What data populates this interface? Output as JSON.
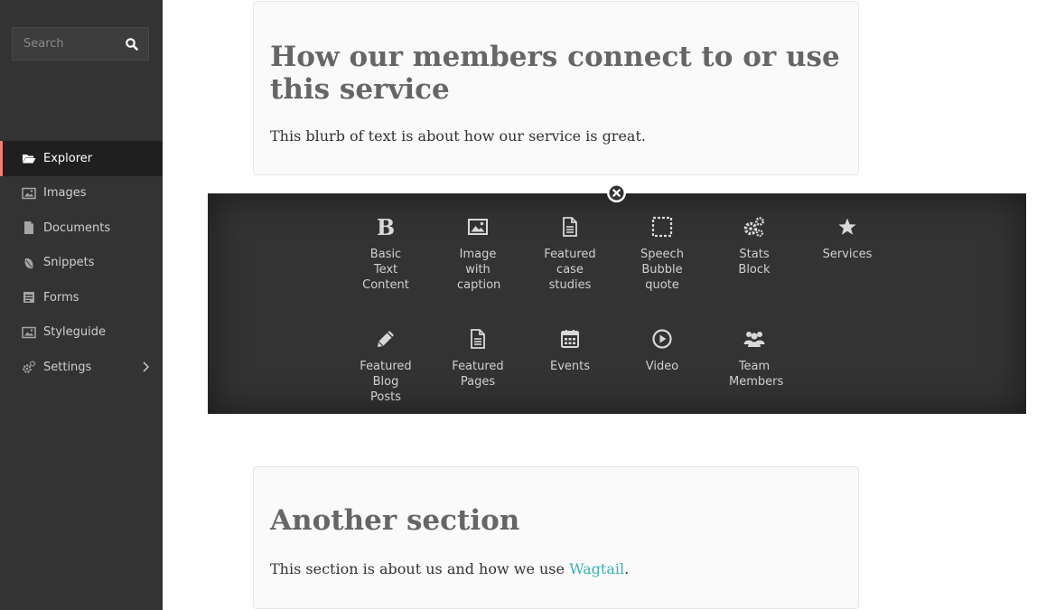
{
  "sidebar": {
    "search": {
      "placeholder": "Search"
    },
    "items": [
      {
        "label": "Explorer",
        "icon": "folder-open-icon",
        "active": true
      },
      {
        "label": "Images",
        "icon": "image-icon"
      },
      {
        "label": "Documents",
        "icon": "document-icon"
      },
      {
        "label": "Snippets",
        "icon": "snippet-icon"
      },
      {
        "label": "Forms",
        "icon": "form-icon"
      },
      {
        "label": "Styleguide",
        "icon": "image-icon"
      },
      {
        "label": "Settings",
        "icon": "cogs-icon",
        "has_submenu": true
      }
    ],
    "accent_color": "#f37e77"
  },
  "sections": [
    {
      "heading": "How our members connect to or use this service",
      "body": "This blurb of text is about how our service is great."
    },
    {
      "heading": "Another section",
      "body_before_link": "This section is about us and how we use ",
      "link_text": "Wagtail",
      "body_after_link": "."
    }
  ],
  "block_chooser": {
    "blocks": [
      {
        "label": "Basic Text Content",
        "icon": "bold-icon"
      },
      {
        "label": "Image with caption",
        "icon": "image-icon"
      },
      {
        "label": "Featured case studies",
        "icon": "document-icon"
      },
      {
        "label": "Speech Bubble quote",
        "icon": "dashed-square-icon"
      },
      {
        "label": "Stats Block",
        "icon": "cogs-icon"
      },
      {
        "label": "Services",
        "icon": "star-icon"
      },
      {
        "label": "Featured Blog Posts",
        "icon": "pencil-icon"
      },
      {
        "label": "Featured Pages",
        "icon": "document-icon"
      },
      {
        "label": "Events",
        "icon": "calendar-icon"
      },
      {
        "label": "Video",
        "icon": "play-circle-icon"
      },
      {
        "label": "Team Members",
        "icon": "group-icon"
      }
    ]
  },
  "colors": {
    "link": "#3bb0b3",
    "sidebar_bg": "#333333"
  }
}
